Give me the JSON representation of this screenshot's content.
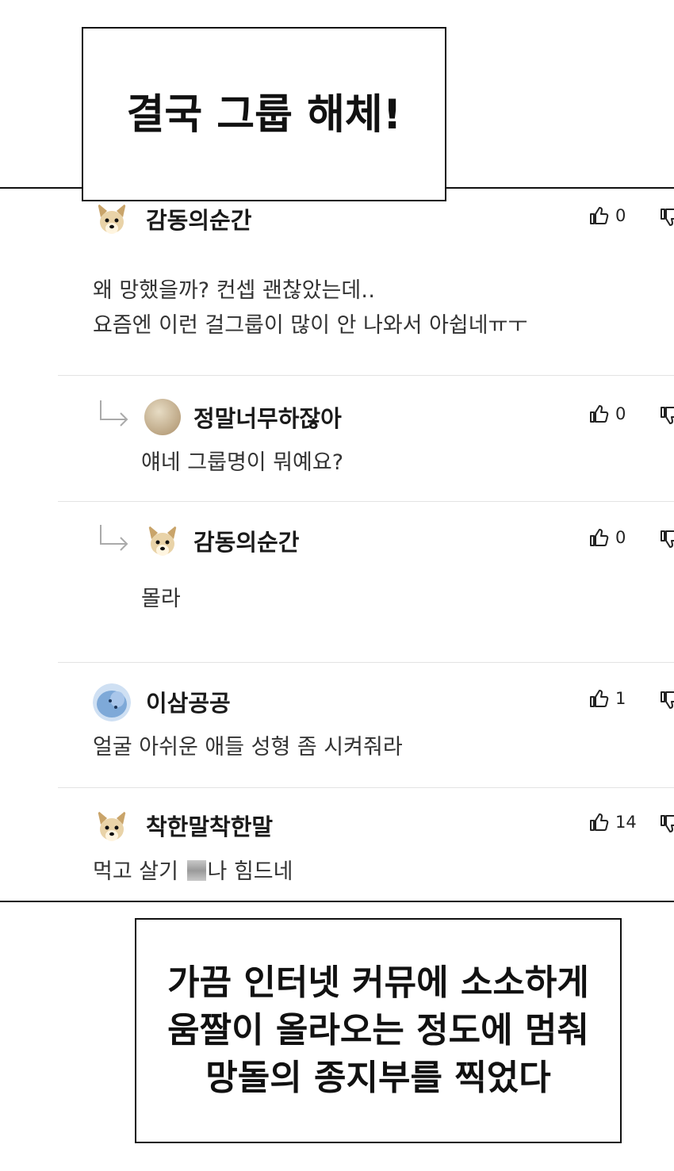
{
  "captions": {
    "top": "결국 그룹 해체!",
    "bottom": [
      "가끔 인터넷 커뮤에 소소하게",
      "움짤이 올라오는 정도에 멈춰",
      "망돌의 종지부를 찍었다"
    ]
  },
  "comments": [
    {
      "nickname": "감동의순간",
      "avatar": "dog-avatar-icon",
      "likes": "0",
      "is_reply": false,
      "lines": [
        "왜 망했을까? 컨셉 괜찮았는데‥",
        "요즘엔 이런 걸그룹이 많이 안 나와서 아쉽네ㅠㅜ"
      ]
    },
    {
      "nickname": "정말너무하잖아",
      "avatar": "beige-circle-avatar-icon",
      "likes": "0",
      "is_reply": true,
      "lines": [
        "얘네 그룹명이 뭐예요?"
      ]
    },
    {
      "nickname": "감동의순간",
      "avatar": "dog-avatar-icon",
      "likes": "0",
      "is_reply": true,
      "lines": [
        "몰라"
      ]
    },
    {
      "nickname": "이삼공공",
      "avatar": "blue-creature-avatar-icon",
      "likes": "1",
      "is_reply": false,
      "lines": [
        "얼굴 아쉬운 애들 성형 좀 시켜줘라"
      ]
    },
    {
      "nickname": "착한말착한말",
      "avatar": "dog-avatar-icon",
      "likes": "14",
      "is_reply": false,
      "lines_parts": {
        "before": "먹고 살기 ",
        "after": "나 힘드네"
      }
    }
  ],
  "colors": {
    "border": "#111111",
    "separator": "#e3e3e3",
    "text": "#333333"
  }
}
